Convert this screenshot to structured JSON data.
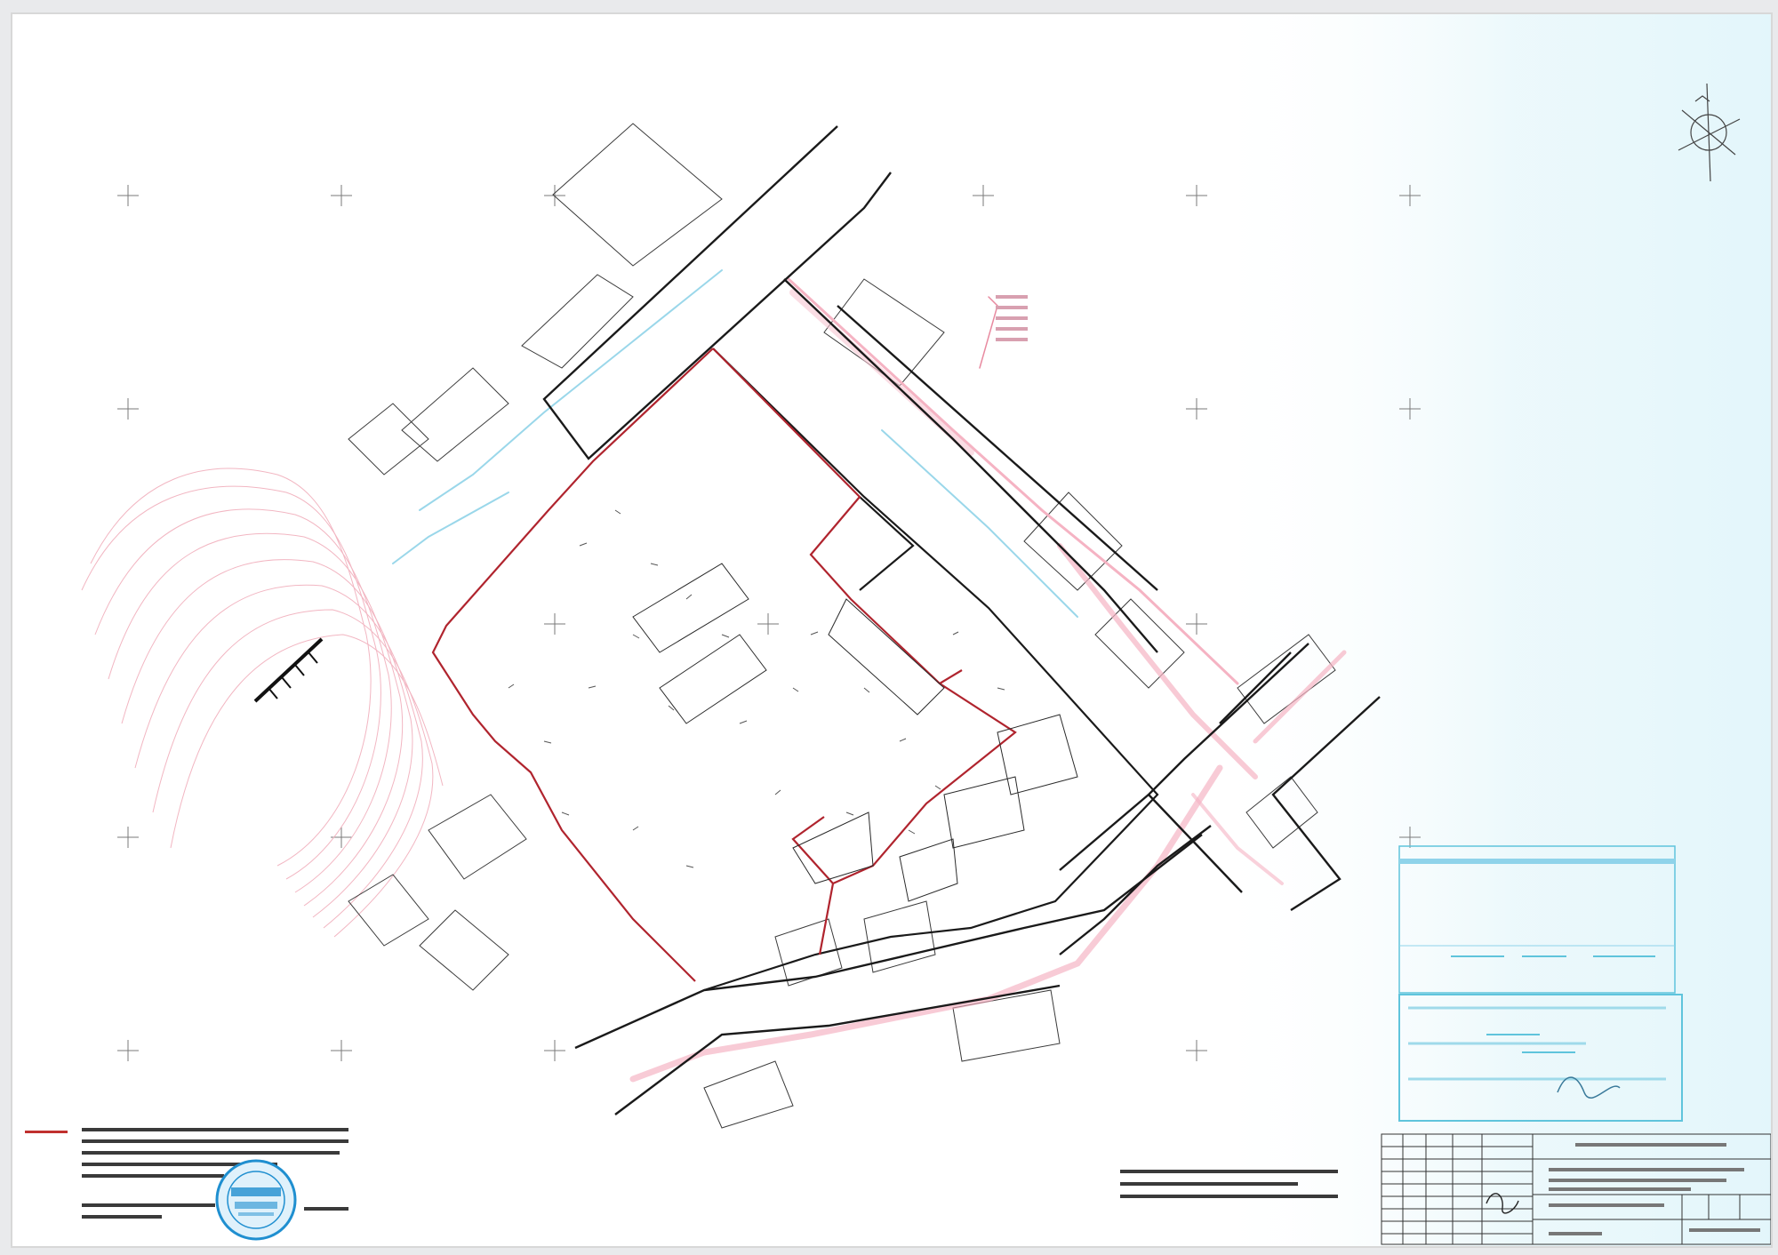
{
  "sheet": {
    "surveyed_area_label": "",
    "north_arrow_icon": "north-arrow-icon"
  },
  "approval_stamp": {
    "line_1": "",
    "line_2": "",
    "line_3": ""
  },
  "left_note": {
    "line_1": "",
    "line_2": ""
  },
  "bottom_note": {
    "line_1": "",
    "line_2": ""
  },
  "title_block": {
    "row_1": "",
    "row_2": ""
  },
  "colors": {
    "base_lines": "#1a1a1a",
    "boundary_red": "#b0242e",
    "utilities_pink": "#f3a6b8",
    "utilities_cyan": "#8fd3ea",
    "stamp_cyan": "#5fc4dc",
    "seal_blue": "#1f8fd0",
    "background_tint": "#e6f7fb"
  }
}
